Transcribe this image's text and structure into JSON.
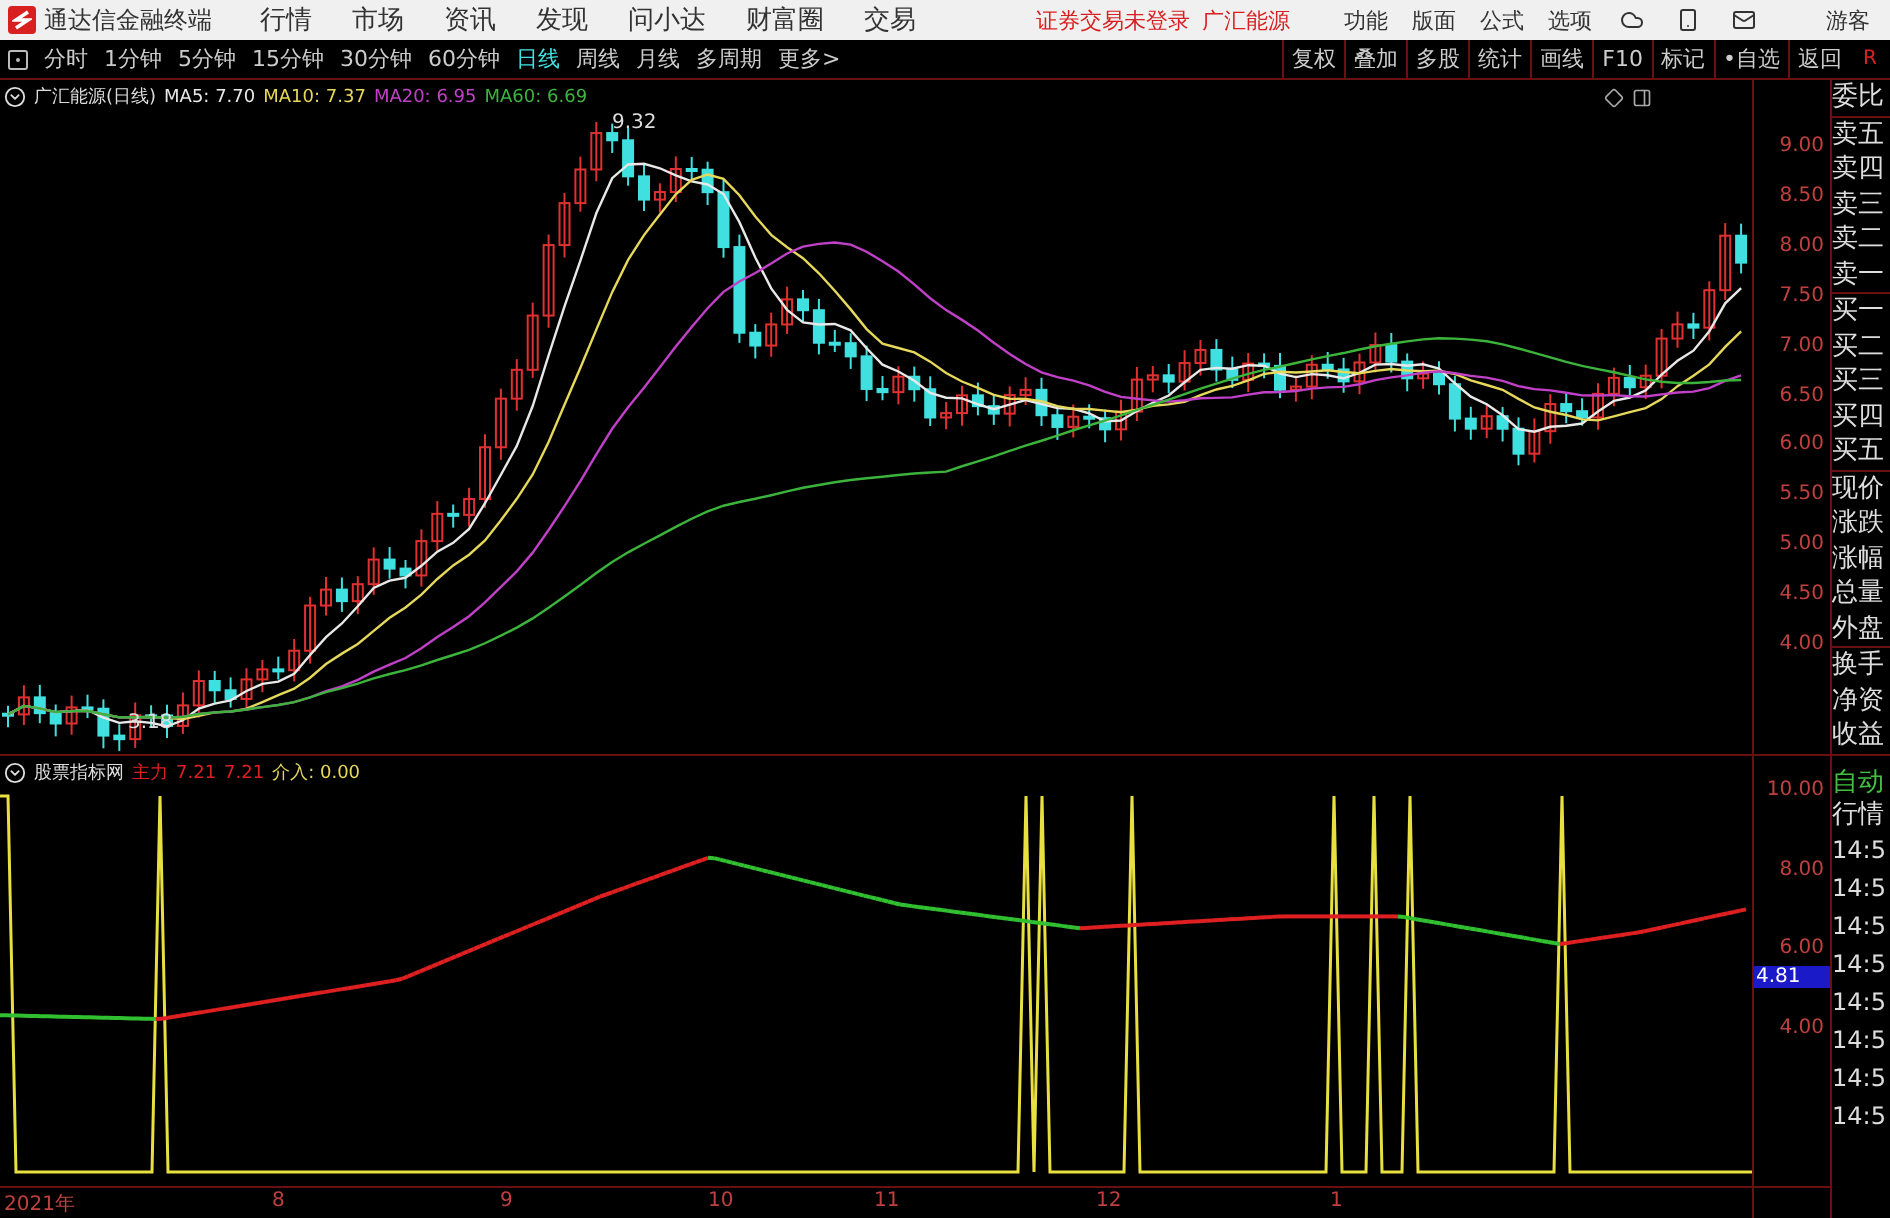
{
  "title_bar": {
    "app_name": "通达信金融终端",
    "menu": [
      "行情",
      "市场",
      "资讯",
      "发现",
      "问小达",
      "财富圈",
      "交易"
    ],
    "login_notice": "证券交易未登录",
    "stock": "广汇能源",
    "tools": [
      "功能",
      "版面",
      "公式",
      "选项"
    ],
    "user": "游客"
  },
  "period_bar": {
    "periods": [
      {
        "label": "分时",
        "selected": false
      },
      {
        "label": "1分钟",
        "selected": false
      },
      {
        "label": "5分钟",
        "selected": false
      },
      {
        "label": "15分钟",
        "selected": false
      },
      {
        "label": "30分钟",
        "selected": false
      },
      {
        "label": "60分钟",
        "selected": false
      },
      {
        "label": "日线",
        "selected": true
      },
      {
        "label": "周线",
        "selected": false
      },
      {
        "label": "月线",
        "selected": false
      },
      {
        "label": "多周期",
        "selected": false
      },
      {
        "label": "更多>",
        "selected": false
      }
    ],
    "tools": [
      "复权",
      "叠加",
      "多股",
      "统计",
      "画线",
      "F10",
      "标记",
      "•自选",
      "返回"
    ],
    "corner": "R"
  },
  "main_chart": {
    "legend_title": "广汇能源(日线)",
    "moving_averages": [
      {
        "label": "MA5: 7.70",
        "color": "#e8e8e8"
      },
      {
        "label": "MA10: 7.37",
        "color": "#e6d85a"
      },
      {
        "label": "MA20: 6.95",
        "color": "#c040c8"
      },
      {
        "label": "MA60: 6.69",
        "color": "#3cb43c"
      }
    ],
    "high_label": "9.32",
    "low_label": "3.18",
    "y_ticks": [
      "9.00",
      "8.50",
      "8.00",
      "7.50",
      "7.00",
      "6.50",
      "6.00",
      "5.50",
      "5.00",
      "4.50",
      "4.00"
    ]
  },
  "indicator": {
    "name": "股票指标网",
    "main_label": "主力",
    "values": [
      "7.21",
      "7.21"
    ],
    "entry": "介入: 0.00",
    "y_ticks": [
      "10.00",
      "8.00",
      "6.00",
      "4.00"
    ],
    "current_value": "4.81"
  },
  "date_axis": [
    "2021年",
    "8",
    "9",
    "10",
    "11",
    "12",
    "1"
  ],
  "quote_labels": [
    [
      "委比"
    ],
    [
      "卖五",
      "卖四",
      "卖三",
      "卖二",
      "卖一"
    ],
    [
      "买一",
      "买二",
      "买三",
      "买四",
      "买五"
    ],
    [
      "现价",
      "涨跌",
      "涨幅",
      "总量",
      "外盘"
    ],
    [
      "换手",
      "净资",
      "收益"
    ]
  ],
  "side_tabs": [
    "自动",
    "行情"
  ],
  "times": [
    "14:5",
    "14:5",
    "14:5",
    "14:5",
    "14:5",
    "14:5",
    "14:5",
    "14:5"
  ]
}
